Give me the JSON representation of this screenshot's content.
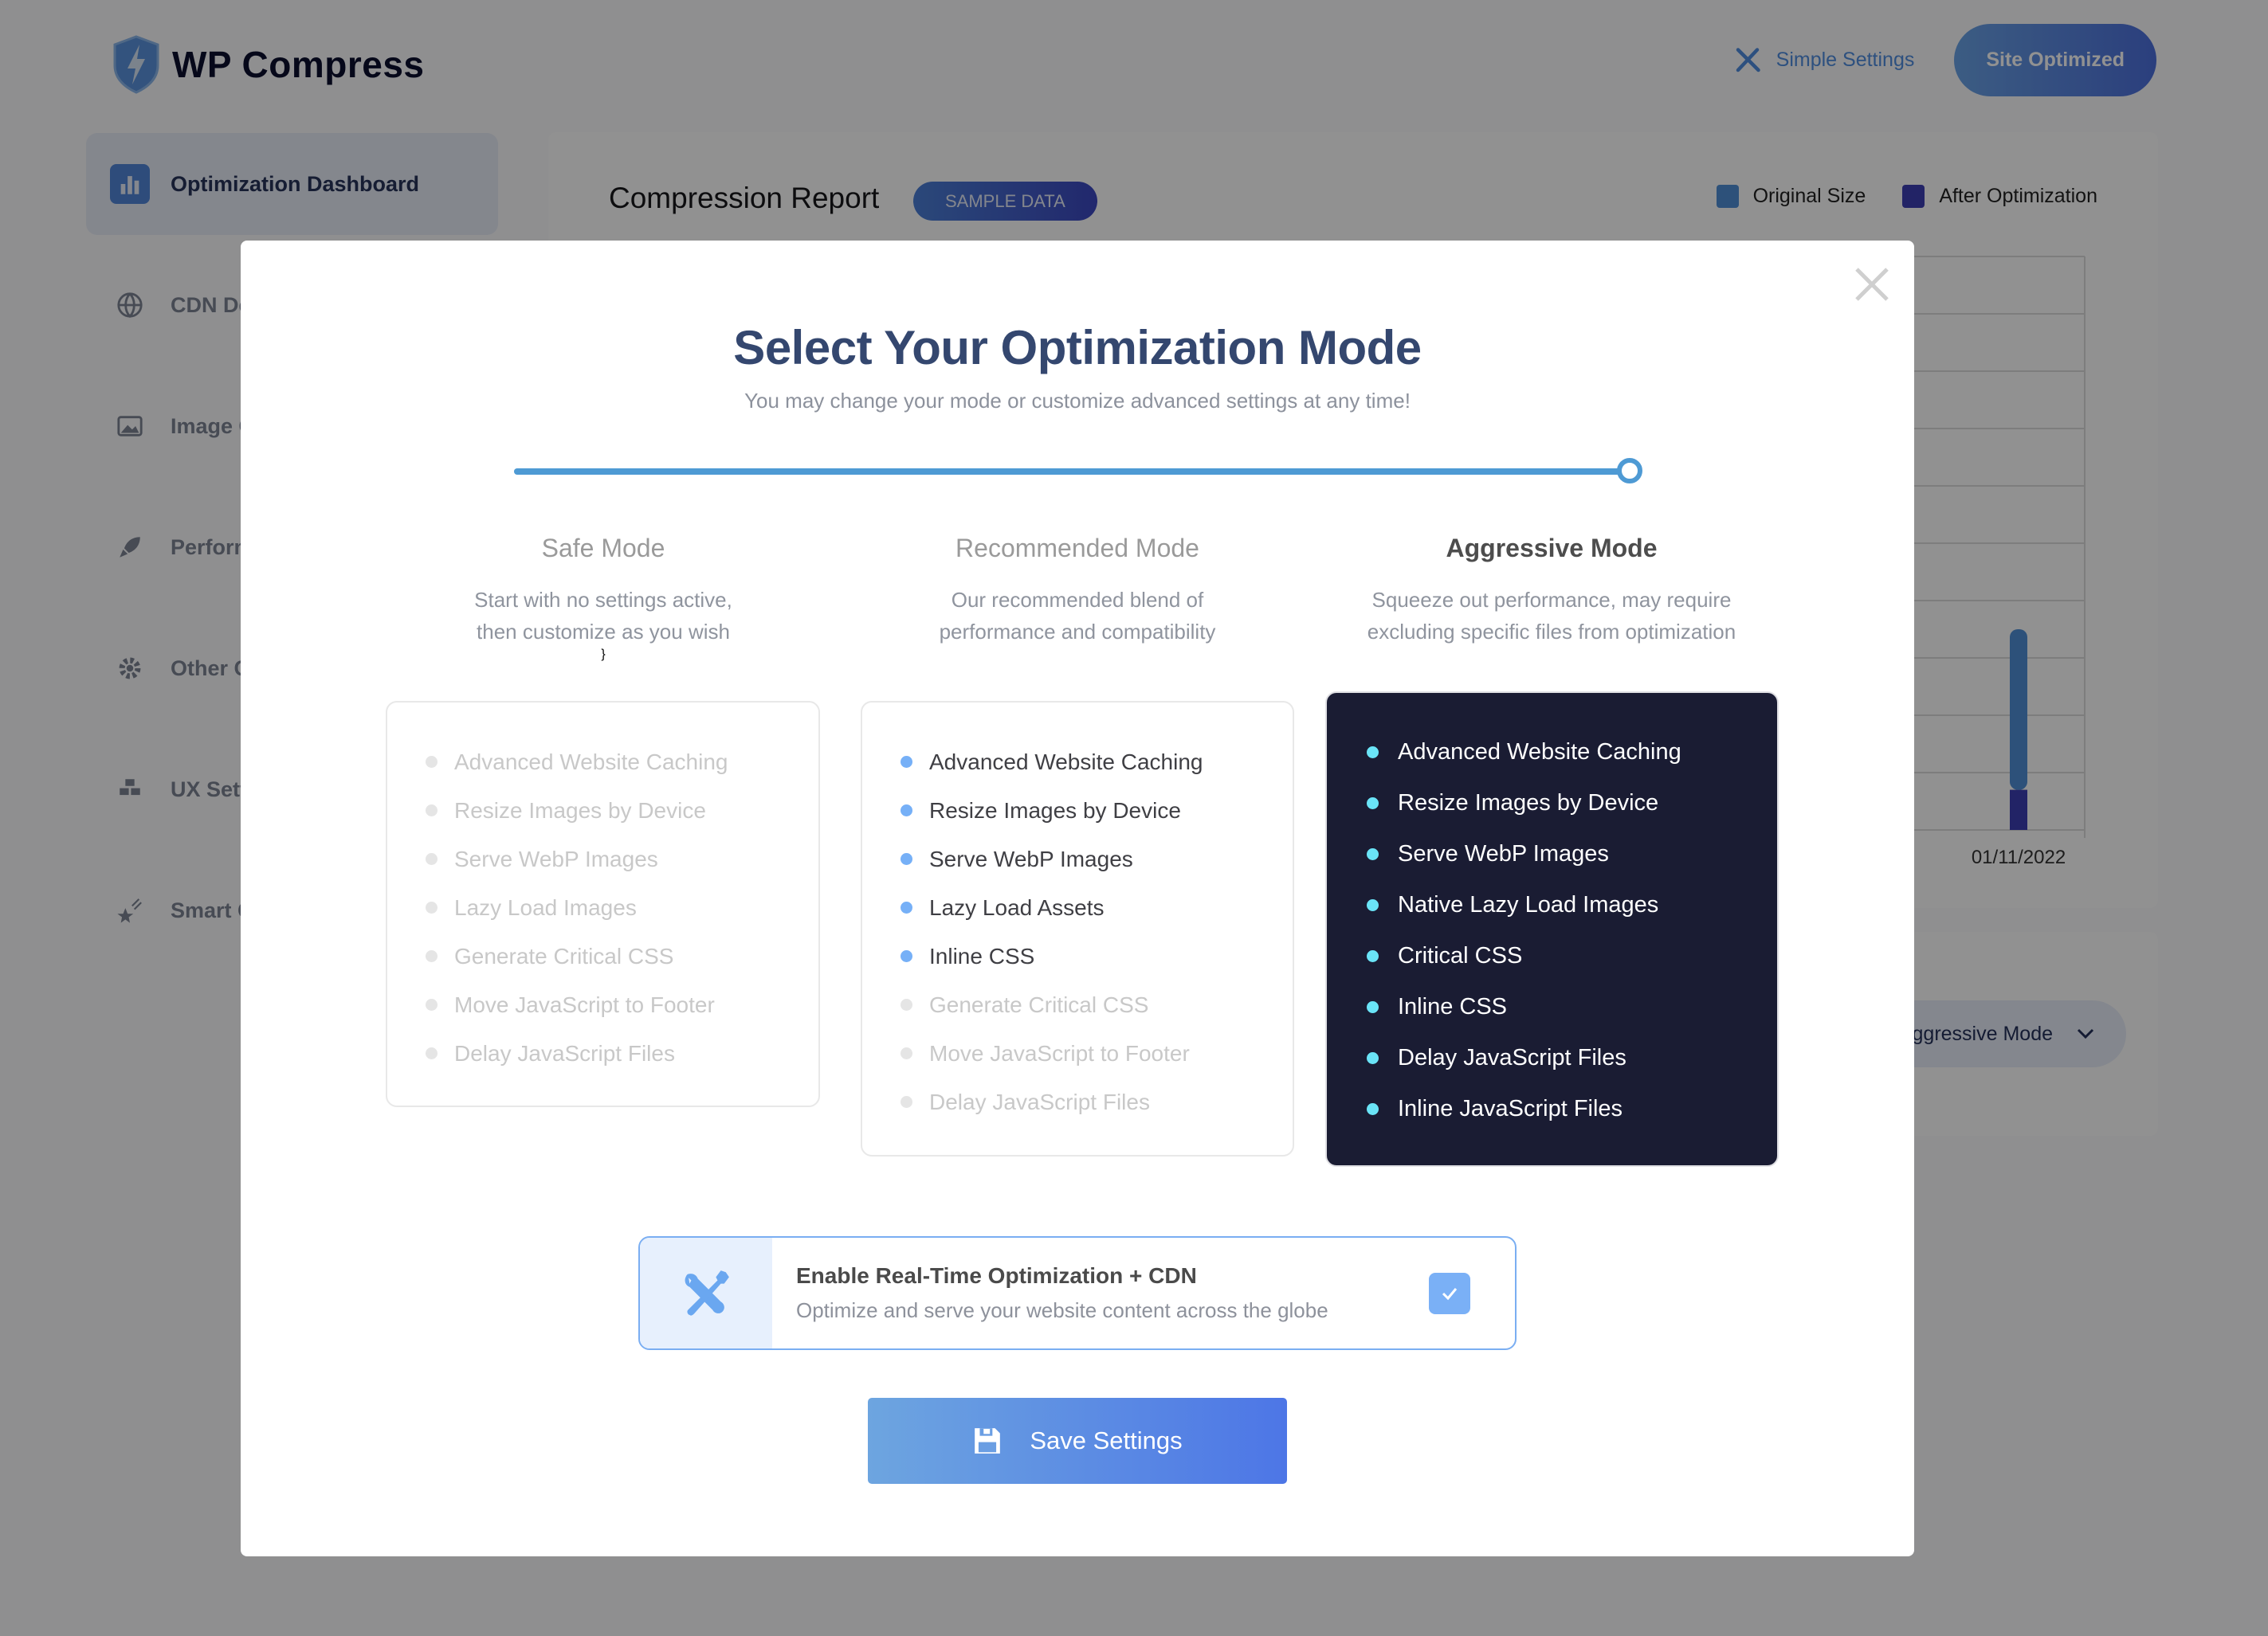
{
  "header": {
    "brand": "WP Compress",
    "simple_settings_label": "Simple Settings",
    "status_button_label": "Site Optimized"
  },
  "sidebar": {
    "items": [
      {
        "label": "Optimization Dashboard",
        "icon": "bar-chart-icon",
        "active": true
      },
      {
        "label": "CDN De",
        "icon": "globe-icon",
        "active": false
      },
      {
        "label": "Image C",
        "icon": "image-icon",
        "active": false
      },
      {
        "label": "Perform",
        "icon": "rocket-icon",
        "active": false
      },
      {
        "label": "Other C",
        "icon": "gear-icon",
        "active": false
      },
      {
        "label": "UX Sett",
        "icon": "cubes-icon",
        "active": false
      },
      {
        "label": "Smart C",
        "icon": "shooting-star-icon",
        "active": false
      }
    ]
  },
  "report": {
    "title": "Compression Report",
    "badge": "SAMPLE DATA",
    "legend": [
      {
        "label": "Original Size",
        "color": "#4f8fd6"
      },
      {
        "label": "After Optimization",
        "color": "#3c3fb4"
      }
    ]
  },
  "chart_data": {
    "type": "bar",
    "stacked": true,
    "title": "Compression Report",
    "categories": [
      "01/11/2022"
    ],
    "series": [
      {
        "name": "After Optimization",
        "values": [
          0.7
        ],
        "color": "#3c3fb4"
      },
      {
        "name": "Original Size",
        "values": [
          2.8
        ],
        "color": "#4f8fd6"
      }
    ],
    "ylim": [
      0,
      10
    ],
    "grid": true,
    "legend_position": "top-right",
    "xlabel": "",
    "ylabel": ""
  },
  "mode_dropdown": {
    "value": "Aggressive Mode"
  },
  "modal": {
    "title": "Select Your Optimization Mode",
    "subtitle": "You may change your mode or customize advanced settings at any time!",
    "slider_position": 1.0,
    "selected_mode": "aggressive",
    "modes": [
      {
        "id": "safe",
        "name": "Safe Mode",
        "desc_line1": "Start with no settings active,",
        "desc_line2": "then customize as you wish",
        "features": [
          {
            "label": "Advanced Website Caching",
            "enabled": false
          },
          {
            "label": "Resize Images by Device",
            "enabled": false
          },
          {
            "label": "Serve WebP Images",
            "enabled": false
          },
          {
            "label": "Lazy Load Images",
            "enabled": false
          },
          {
            "label": "Generate Critical CSS",
            "enabled": false
          },
          {
            "label": "Move JavaScript to Footer",
            "enabled": false
          },
          {
            "label": "Delay JavaScript Files",
            "enabled": false
          }
        ]
      },
      {
        "id": "recommended",
        "name": "Recommended Mode",
        "desc_line1": "Our recommended blend of",
        "desc_line2": "performance and compatibility",
        "features": [
          {
            "label": "Advanced Website Caching",
            "enabled": true
          },
          {
            "label": "Resize Images by Device",
            "enabled": true
          },
          {
            "label": "Serve WebP Images",
            "enabled": true
          },
          {
            "label": "Lazy Load Assets",
            "enabled": true
          },
          {
            "label": "Inline CSS",
            "enabled": true
          },
          {
            "label": "Generate Critical CSS",
            "enabled": false
          },
          {
            "label": "Move JavaScript to Footer",
            "enabled": false
          },
          {
            "label": "Delay JavaScript Files",
            "enabled": false
          }
        ]
      },
      {
        "id": "aggressive",
        "name": "Aggressive Mode",
        "desc_line1": "Squeeze out performance, may require",
        "desc_line2": "excluding specific files from optimization",
        "features": [
          {
            "label": "Advanced Website Caching",
            "enabled": true
          },
          {
            "label": "Resize Images by Device",
            "enabled": true
          },
          {
            "label": "Serve WebP Images",
            "enabled": true
          },
          {
            "label": "Native Lazy Load Images",
            "enabled": true
          },
          {
            "label": "Critical CSS",
            "enabled": true
          },
          {
            "label": "Inline CSS",
            "enabled": true
          },
          {
            "label": "Delay JavaScript Files",
            "enabled": true
          },
          {
            "label": "Inline JavaScript Files",
            "enabled": true
          }
        ]
      }
    ],
    "realtime": {
      "title": "Enable Real-Time Optimization + CDN",
      "description": "Optimize and serve your website content across the globe",
      "checked": true
    },
    "save_label": "Save Settings"
  }
}
